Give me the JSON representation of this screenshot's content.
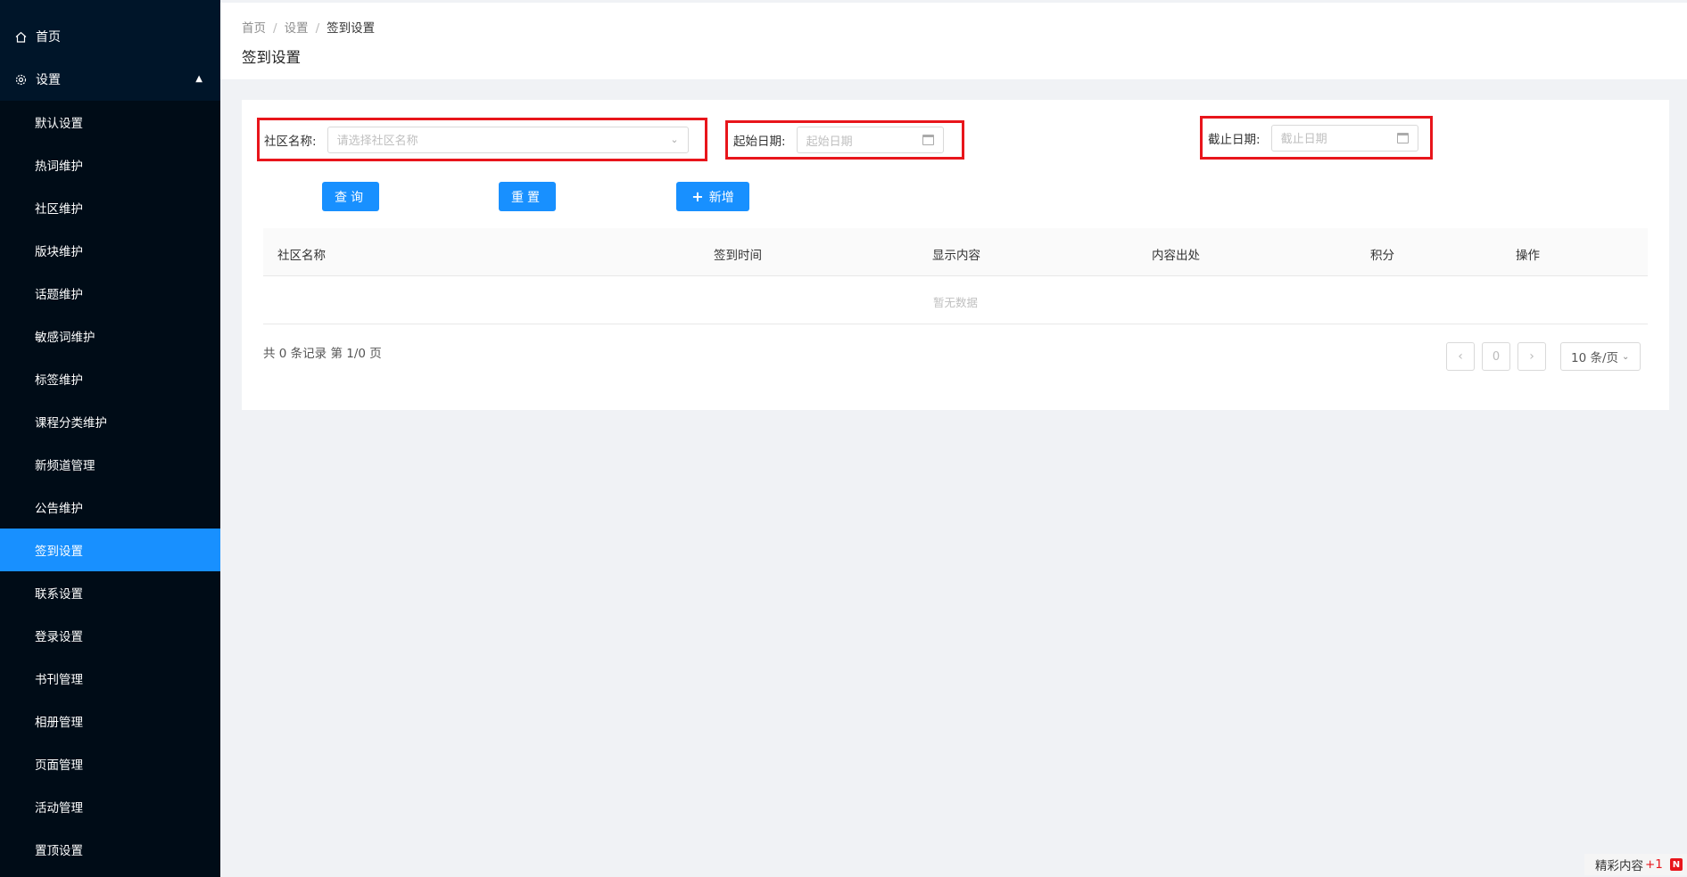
{
  "sidebar": {
    "home": {
      "label": "首页",
      "icon": "home-icon"
    },
    "settings_group": {
      "label": "设置",
      "icon": "gear-icon",
      "expanded": true
    },
    "items": [
      {
        "label": "默认设置"
      },
      {
        "label": "热词维护"
      },
      {
        "label": "社区维护"
      },
      {
        "label": "版块维护"
      },
      {
        "label": "话题维护"
      },
      {
        "label": "敏感词维护"
      },
      {
        "label": "标签维护"
      },
      {
        "label": "课程分类维护"
      },
      {
        "label": "新频道管理"
      },
      {
        "label": "公告维护"
      },
      {
        "label": "签到设置",
        "active": true
      },
      {
        "label": "联系设置"
      },
      {
        "label": "登录设置"
      },
      {
        "label": "书刊管理"
      },
      {
        "label": "相册管理"
      },
      {
        "label": "页面管理"
      },
      {
        "label": "活动管理"
      },
      {
        "label": "置顶设置"
      }
    ]
  },
  "breadcrumb": [
    "首页",
    "设置",
    "签到设置"
  ],
  "page_title": "签到设置",
  "filters": {
    "community": {
      "label": "社区名称:",
      "placeholder": "请选择社区名称"
    },
    "start_date": {
      "label": "起始日期:",
      "placeholder": "起始日期"
    },
    "end_date": {
      "label": "截止日期:",
      "placeholder": "截止日期"
    }
  },
  "buttons": {
    "search": "查询",
    "reset": "重置",
    "add": "新增"
  },
  "table": {
    "columns": [
      "社区名称",
      "签到时间",
      "显示内容",
      "内容出处",
      "积分",
      "操作"
    ],
    "empty_text": "暂无数据"
  },
  "pagination": {
    "summary": "共 0 条记录 第 1/0 页",
    "current_page": "0",
    "page_size": "10 条/页"
  },
  "float_badge": {
    "text": "精彩内容",
    "count": "+1",
    "logo": "N"
  },
  "colors": {
    "sidebar_bg": "#001529",
    "accent": "#1890ff",
    "highlight_border": "#e8151b"
  }
}
